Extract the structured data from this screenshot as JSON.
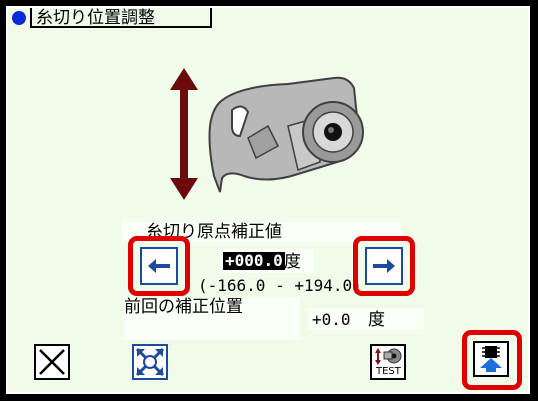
{
  "title": "糸切り位置調整",
  "section_label": "糸切り原点補正値",
  "value": "+000.0",
  "unit": "度",
  "range": "(-166.0 - +194.0)",
  "previous_label": "前回の補正位置",
  "previous_value": "+0.0",
  "previous_unit": "度",
  "buttons": {
    "decrease": "left-arrow-icon",
    "increase": "right-arrow-icon",
    "close": "close-icon",
    "reset": "origin-reset-icon",
    "test": "TEST",
    "write": "write-memory-icon"
  },
  "colors": {
    "background": "#f1fbea",
    "highlight": "#e00000",
    "arrow_blue": "#1c4aa0",
    "move_arrow": "#6b0a0a"
  }
}
